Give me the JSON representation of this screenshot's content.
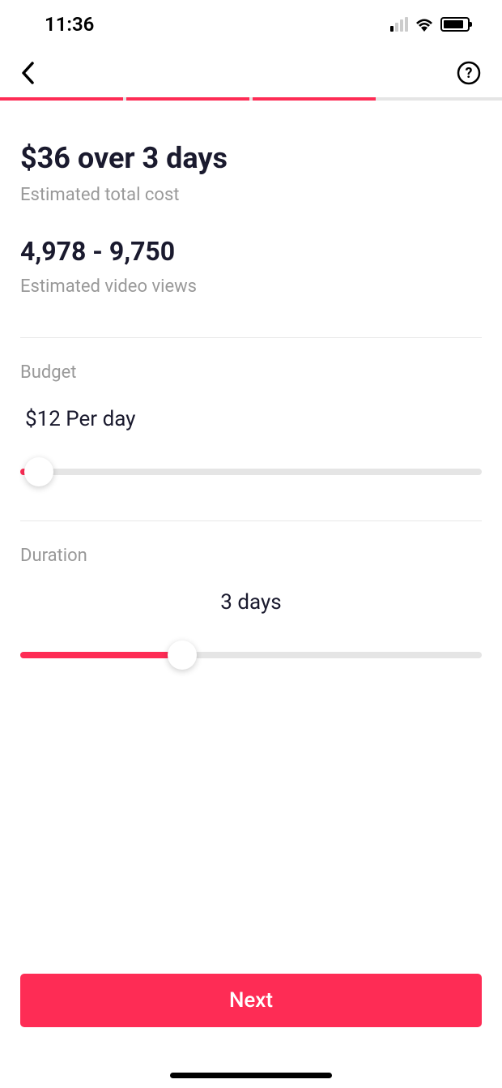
{
  "status": {
    "time": "11:36"
  },
  "progress": {
    "total_steps": 4,
    "current_step": 3
  },
  "summary": {
    "cost_headline": "$36 over 3 days",
    "cost_subtitle": "Estimated total cost",
    "views_headline": "4,978 - 9,750",
    "views_subtitle": "Estimated video views"
  },
  "budget": {
    "label": "Budget",
    "value_display": "$12 Per day",
    "slider_percent": 4
  },
  "duration": {
    "label": "Duration",
    "value_display": "3 days",
    "slider_percent": 35
  },
  "actions": {
    "next_label": "Next"
  },
  "colors": {
    "accent": "#fe2c55"
  }
}
